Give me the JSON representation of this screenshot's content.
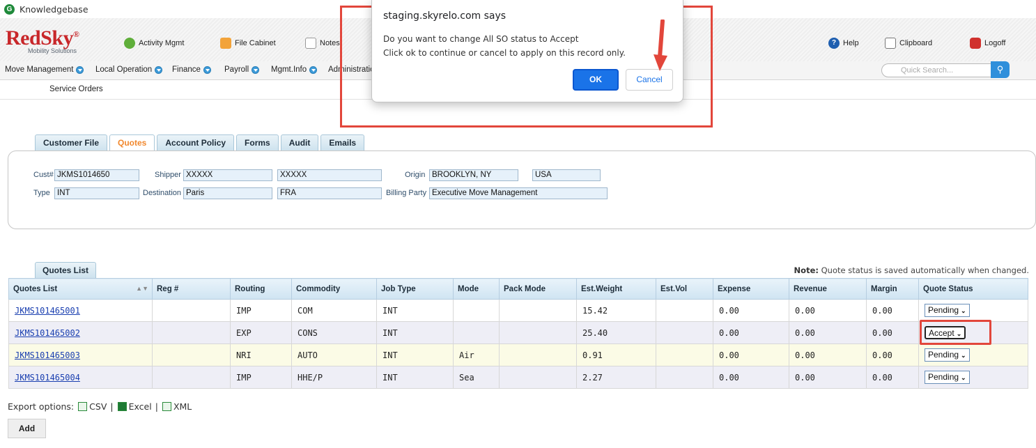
{
  "browser": {
    "tab_title": "Knowledgebase"
  },
  "header": {
    "logo_text": "RedSky",
    "logo_sub": "Mobility Solutions",
    "links": {
      "activity": "Activity Mgmt",
      "file_cabinet": "File Cabinet",
      "notes": "Notes",
      "help": "Help",
      "clipboard": "Clipboard",
      "logoff": "Logoff"
    }
  },
  "menu": {
    "items": [
      "Move Management",
      "Local Operation",
      "Finance",
      "Payroll",
      "Mgmt.Info",
      "Administratio"
    ],
    "search_placeholder": "Quick Search..."
  },
  "subnav": {
    "label": "Service Orders"
  },
  "tabs": [
    "Customer File",
    "Quotes",
    "Account Policy",
    "Forms",
    "Audit",
    "Emails"
  ],
  "customer": {
    "cust_label": "Cust#",
    "cust_value": "JKMS1014650",
    "shipper_label": "Shipper",
    "shipper_first": "XXXXX",
    "shipper_last": "XXXXX",
    "origin_label": "Origin",
    "origin_city": "BROOKLYN, NY",
    "origin_country": "USA",
    "type_label": "Type",
    "type_value": "INT",
    "dest_label": "Destination",
    "dest_city": "Paris",
    "dest_country": "FRA",
    "billing_label": "Billing Party",
    "billing_value": "Executive Move Management"
  },
  "quotes": {
    "tab_label": "Quotes List",
    "note_bold": "Note:",
    "note_text": " Quote status is saved automatically when changed.",
    "columns": [
      "Quotes List",
      "Reg #",
      "Routing",
      "Commodity",
      "Job Type",
      "Mode",
      "Pack Mode",
      "Est.Weight",
      "Est.Vol",
      "Expense",
      "Revenue",
      "Margin",
      "Quote Status"
    ],
    "rows": [
      {
        "id": "JKMS101465001",
        "reg": "",
        "routing": "IMP",
        "commodity": "COM",
        "job_type": "INT",
        "mode": "",
        "pack_mode": "",
        "weight": "15.42",
        "vol": "",
        "expense": "0.00",
        "revenue": "0.00",
        "margin": "0.00",
        "status": "Pending"
      },
      {
        "id": "JKMS101465002",
        "reg": "",
        "routing": "EXP",
        "commodity": "CONS",
        "job_type": "INT",
        "mode": "",
        "pack_mode": "",
        "weight": "25.40",
        "vol": "",
        "expense": "0.00",
        "revenue": "0.00",
        "margin": "0.00",
        "status": "Accept"
      },
      {
        "id": "JKMS101465003",
        "reg": "",
        "routing": "NRI",
        "commodity": "AUTO",
        "job_type": "INT",
        "mode": "Air",
        "pack_mode": "",
        "weight": "0.91",
        "vol": "",
        "expense": "0.00",
        "revenue": "0.00",
        "margin": "0.00",
        "status": "Pending"
      },
      {
        "id": "JKMS101465004",
        "reg": "",
        "routing": "IMP",
        "commodity": "HHE/P",
        "job_type": "INT",
        "mode": "Sea",
        "pack_mode": "",
        "weight": "2.27",
        "vol": "",
        "expense": "0.00",
        "revenue": "0.00",
        "margin": "0.00",
        "status": "Pending"
      }
    ]
  },
  "export": {
    "label": "Export options:",
    "csv": "CSV",
    "excel": "Excel",
    "xml": "XML",
    "sep": "|"
  },
  "add_button": "Add",
  "dialog": {
    "title": "staging.skyrelo.com says",
    "line1": "Do you want to change All SO status to Accept",
    "line2": "Click ok to continue or cancel to apply on this record only.",
    "ok": "OK",
    "cancel": "Cancel"
  },
  "colors": {
    "highlight": "#e2463b",
    "ok_button": "#1a73e8",
    "brand_red": "#c8272a"
  }
}
